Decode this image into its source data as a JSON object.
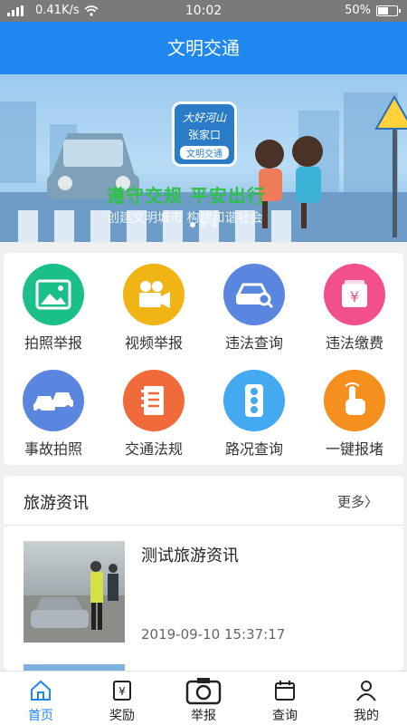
{
  "status_bar": {
    "network": "0.41K/s",
    "time": "10:02",
    "battery": "50%",
    "battery_level": 0.5
  },
  "header": {
    "title": "文明交通"
  },
  "banner": {
    "logo_line1": "大好河山",
    "logo_line2": "张家口",
    "logo_line3": "文明交通",
    "slogan": "遵守交规 平安出行",
    "subtitle": "创建文明城市 构建和谐社会"
  },
  "grid": [
    {
      "label": "拍照举报",
      "icon": "photo-icon",
      "color": "#1bbf8a"
    },
    {
      "label": "视频举报",
      "icon": "video-camera-icon",
      "color": "#f0b414"
    },
    {
      "label": "违法查询",
      "icon": "car-search-icon",
      "color": "#5b86e0"
    },
    {
      "label": "违法缴费",
      "icon": "yuan-payment-icon",
      "color": "#f2508c"
    },
    {
      "label": "事故拍照",
      "icon": "car-accident-icon",
      "color": "#5b86e0"
    },
    {
      "label": "交通法规",
      "icon": "law-book-icon",
      "color": "#f06a3a"
    },
    {
      "label": "路况查询",
      "icon": "traffic-light-icon",
      "color": "#43a9f0"
    },
    {
      "label": "一键报堵",
      "icon": "tap-hand-icon",
      "color": "#f5901e"
    }
  ],
  "news": {
    "title": "旅游资讯",
    "more": "更多",
    "items": [
      {
        "title": "测试旅游资讯",
        "time": "2019-09-10 15:37:17"
      }
    ]
  },
  "tabs": [
    {
      "label": "首页",
      "icon": "home-icon",
      "active": true
    },
    {
      "label": "奖励",
      "icon": "reward-icon",
      "active": false
    },
    {
      "label": "举报",
      "icon": "camera-icon",
      "active": false
    },
    {
      "label": "查询",
      "icon": "calendar-icon",
      "active": false
    },
    {
      "label": "我的",
      "icon": "user-icon",
      "active": false
    }
  ],
  "colors": {
    "primary": "#1e88f0",
    "background": "#f0f0f0"
  }
}
